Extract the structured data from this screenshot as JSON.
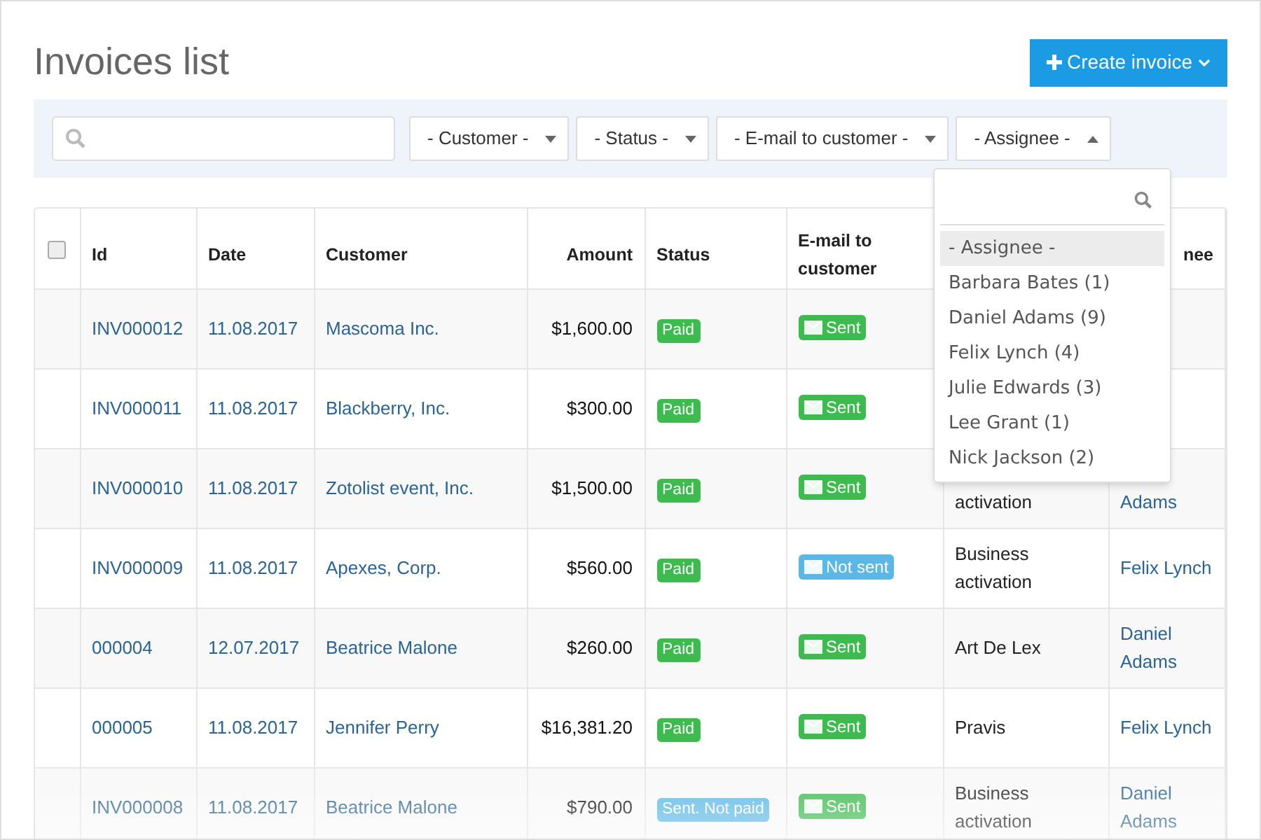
{
  "page": {
    "title": "Invoices list",
    "create_button": "Create invoice"
  },
  "filters": {
    "dropdowns": [
      {
        "label": "- Customer -",
        "expanded": false
      },
      {
        "label": "- Status -",
        "expanded": false
      },
      {
        "label": "- E-mail to customer -",
        "expanded": false
      },
      {
        "label": "- Assignee -",
        "expanded": true
      }
    ]
  },
  "assignee_menu": {
    "items": [
      {
        "label": "- Assignee -",
        "selected": true
      },
      {
        "label": "Barbara Bates (1)",
        "selected": false
      },
      {
        "label": "Daniel Adams (9)",
        "selected": false
      },
      {
        "label": "Felix Lynch (4)",
        "selected": false
      },
      {
        "label": "Julie Edwards (3)",
        "selected": false
      },
      {
        "label": "Lee Grant (1)",
        "selected": false
      },
      {
        "label": "Nick Jackson (2)",
        "selected": false
      }
    ]
  },
  "table": {
    "select_all_checked": false,
    "columns": [
      {
        "label": "Id"
      },
      {
        "label": "Date"
      },
      {
        "label": "Customer"
      },
      {
        "label": "Amount"
      },
      {
        "label": "Status"
      },
      {
        "label": "E-mail to customer"
      },
      {},
      {
        "label": "nee"
      }
    ],
    "rows": [
      {
        "id": "INV000012",
        "date": "11.08.2017",
        "customer": "Mascoma Inc.",
        "amount": "$1,600.00",
        "status": {
          "label": "Paid",
          "kind": "paid"
        },
        "email": {
          "label": "Sent",
          "kind": "sent"
        }
      },
      {
        "id": "INV000011",
        "date": "11.08.2017",
        "customer": "Blackberry, Inc.",
        "amount": "$300.00",
        "status": {
          "label": "Paid",
          "kind": "paid"
        },
        "email": {
          "label": "Sent",
          "kind": "sent"
        }
      },
      {
        "id": "INV000010",
        "date": "11.08.2017",
        "customer": "Zotolist event, Inc.",
        "amount": "$1,500.00",
        "status": {
          "label": "Paid",
          "kind": "paid"
        },
        "email": {
          "label": "Sent",
          "kind": "sent"
        },
        "project": "activation",
        "assignee": "Adams"
      },
      {
        "id": "INV000009",
        "date": "11.08.2017",
        "customer": "Apexes, Corp.",
        "amount": "$560.00",
        "status": {
          "label": "Paid",
          "kind": "paid"
        },
        "email": {
          "label": "Not sent",
          "kind": "not_sent"
        },
        "project": "Business activation",
        "assignee": "Felix Lynch"
      },
      {
        "id": "000004",
        "date": "12.07.2017",
        "customer": "Beatrice Malone",
        "amount": "$260.00",
        "status": {
          "label": "Paid",
          "kind": "paid"
        },
        "email": {
          "label": "Sent",
          "kind": "sent"
        },
        "project": "Art De Lex",
        "assignee": "Daniel Adams"
      },
      {
        "id": "000005",
        "date": "11.08.2017",
        "customer": "Jennifer Perry",
        "amount": "$16,381.20",
        "status": {
          "label": "Paid",
          "kind": "paid"
        },
        "email": {
          "label": "Sent",
          "kind": "sent"
        },
        "project": "Pravis",
        "assignee": "Felix Lynch"
      },
      {
        "id": "INV000008",
        "date": "11.08.2017",
        "customer": "Beatrice Malone",
        "amount": "$790.00",
        "status": {
          "label": "Sent. Not paid",
          "kind": "sent_not_paid"
        },
        "email": {
          "label": "Sent",
          "kind": "sent"
        },
        "project": "Business activation",
        "assignee": "Daniel Adams"
      }
    ]
  }
}
